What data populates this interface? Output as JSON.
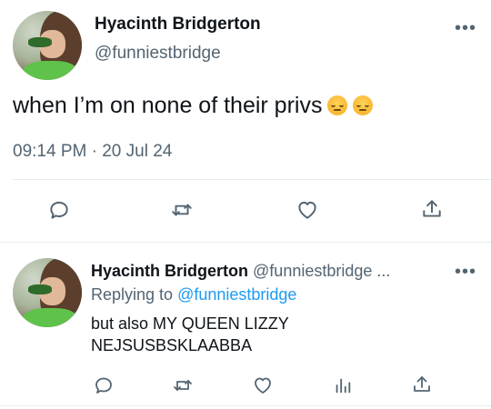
{
  "tweet": {
    "author_name": "Hyacinth Bridgerton",
    "author_handle": "@funniestbridge",
    "more_label": "•••",
    "text": "when I’m on none of their privs",
    "emoji": "pensive-face",
    "timestamp": "09:14 PM · 20 Jul 24",
    "actions": [
      "reply-icon",
      "retweet-icon",
      "like-icon",
      "share-icon"
    ]
  },
  "reply": {
    "author_name": "Hyacinth Bridgerton",
    "author_handle": "@funniestbridge ...",
    "more_label": "•••",
    "replying_prefix": "Replying to",
    "replying_to": "@funniestbridge",
    "text_line1": "but also MY QUEEN LIZZY",
    "text_line2": "NEJSUSBSKLAABBA",
    "actions": [
      "reply-icon",
      "retweet-icon",
      "like-icon",
      "views-icon",
      "share-icon"
    ]
  },
  "colors": {
    "text": "#0f1419",
    "secondary": "#536471",
    "link": "#1d9bf0",
    "divider": "#e6ecf0"
  }
}
